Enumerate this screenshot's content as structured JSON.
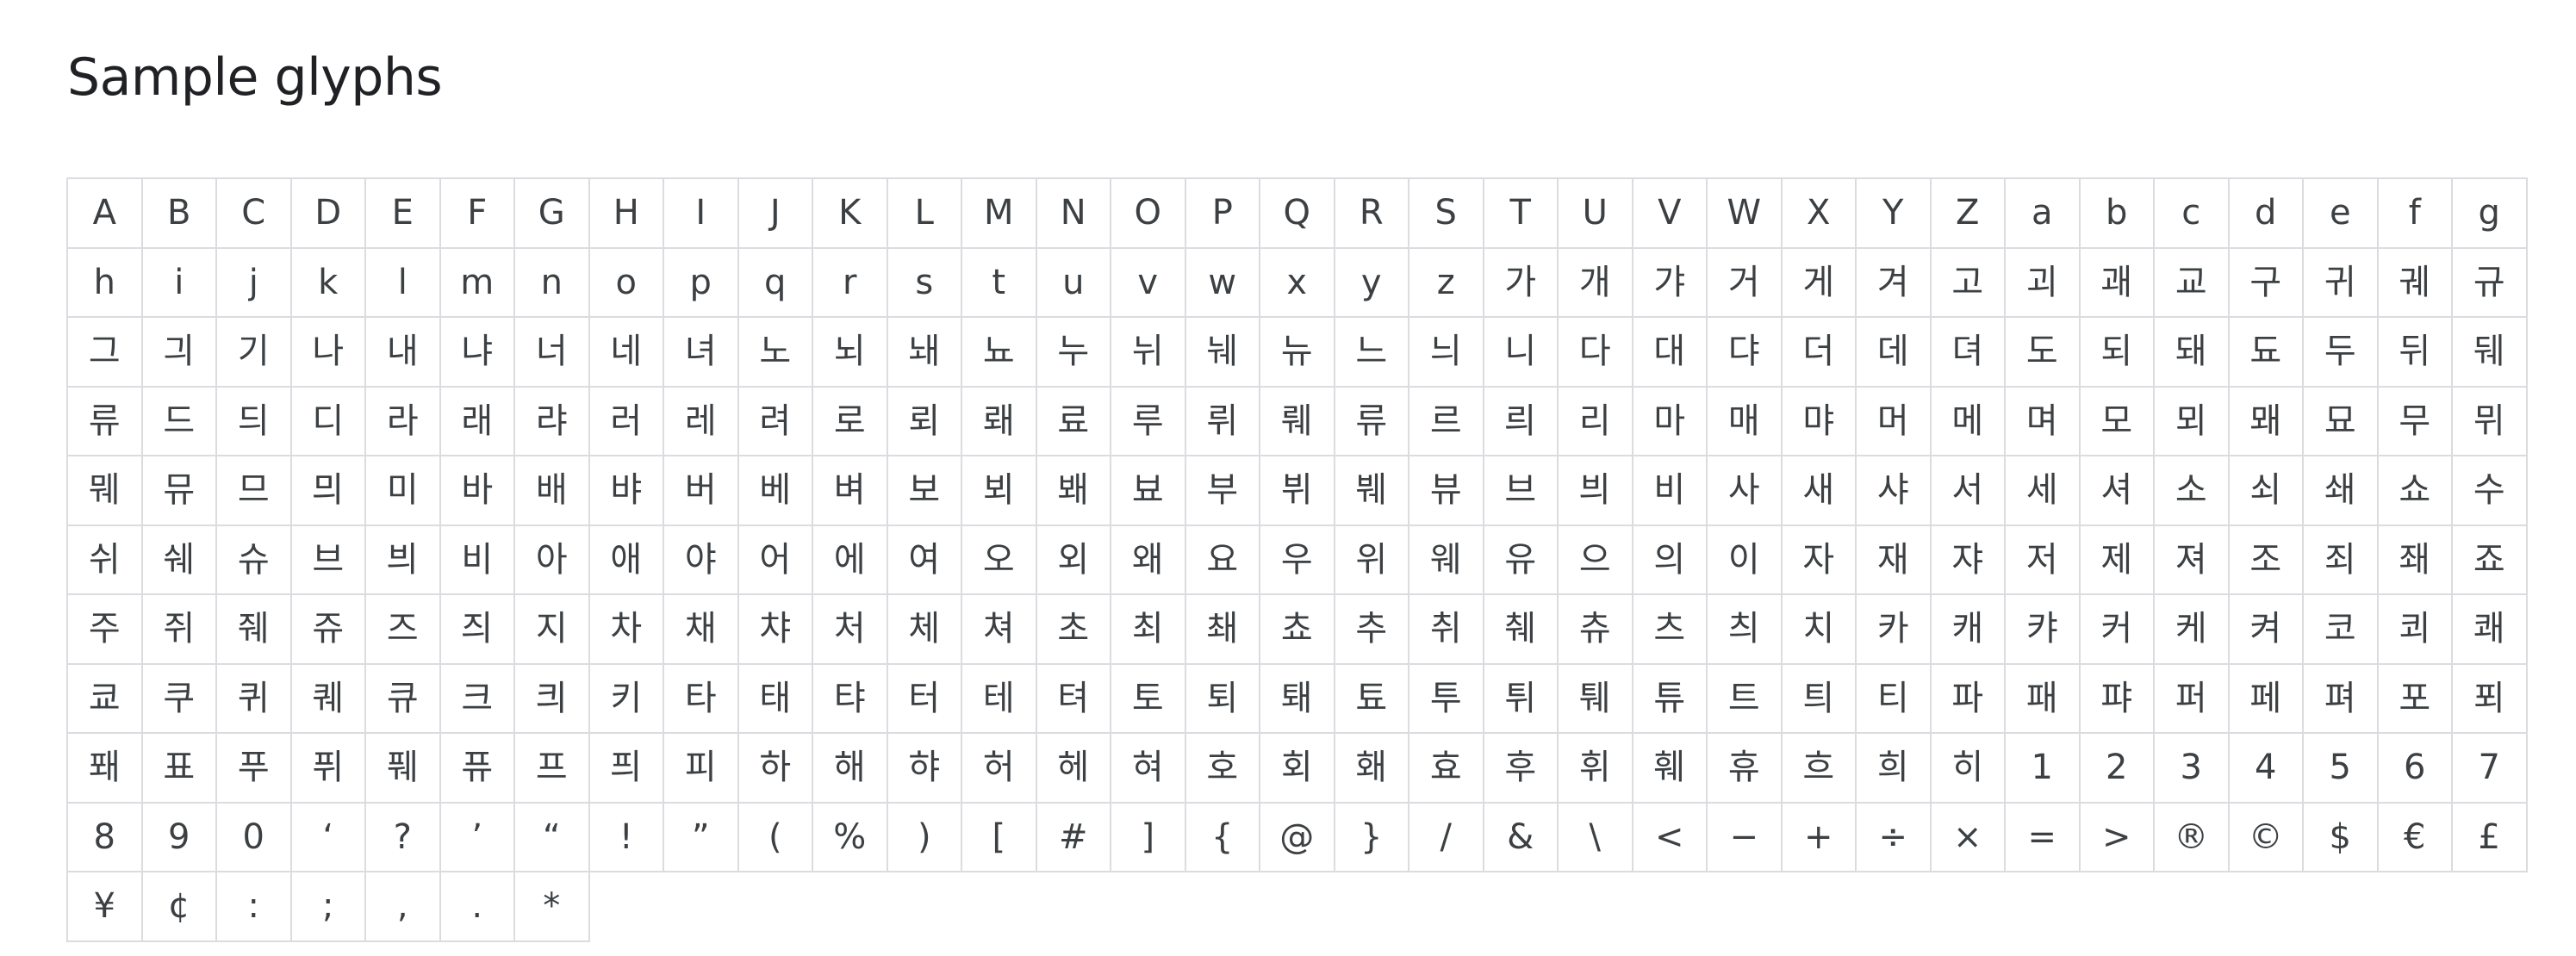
{
  "page": {
    "title": "Sample glyphs"
  },
  "glyphs": [
    "A",
    "B",
    "C",
    "D",
    "E",
    "F",
    "G",
    "H",
    "I",
    "J",
    "K",
    "L",
    "M",
    "N",
    "O",
    "P",
    "Q",
    "R",
    "S",
    "T",
    "U",
    "V",
    "W",
    "X",
    "Y",
    "Z",
    "a",
    "b",
    "c",
    "d",
    "e",
    "f",
    "g",
    "h",
    "i",
    "j",
    "k",
    "l",
    "m",
    "n",
    "o",
    "p",
    "q",
    "r",
    "s",
    "t",
    "u",
    "v",
    "w",
    "x",
    "y",
    "z",
    "가",
    "개",
    "갸",
    "거",
    "게",
    "겨",
    "고",
    "괴",
    "괘",
    "교",
    "구",
    "귀",
    "궤",
    "규",
    "그",
    "긔",
    "기",
    "나",
    "내",
    "냐",
    "너",
    "네",
    "녀",
    "노",
    "뇌",
    "놰",
    "뇨",
    "누",
    "뉘",
    "눼",
    "뉴",
    "느",
    "늬",
    "니",
    "다",
    "대",
    "댜",
    "더",
    "데",
    "뎌",
    "도",
    "되",
    "돼",
    "됴",
    "두",
    "뒤",
    "뒈",
    "류",
    "드",
    "듸",
    "디",
    "라",
    "래",
    "랴",
    "러",
    "레",
    "려",
    "로",
    "뢰",
    "뢔",
    "료",
    "루",
    "뤼",
    "뤠",
    "류",
    "르",
    "릐",
    "리",
    "마",
    "매",
    "먀",
    "머",
    "메",
    "며",
    "모",
    "뫼",
    "뫠",
    "묘",
    "무",
    "뮈",
    "뭬",
    "뮤",
    "므",
    "믜",
    "미",
    "바",
    "배",
    "뱌",
    "버",
    "베",
    "벼",
    "보",
    "뵈",
    "봬",
    "뵤",
    "부",
    "뷔",
    "붸",
    "뷰",
    "브",
    "븨",
    "비",
    "사",
    "새",
    "샤",
    "서",
    "세",
    "셔",
    "소",
    "쇠",
    "쇄",
    "쇼",
    "수",
    "쉬",
    "쉐",
    "슈",
    "브",
    "븨",
    "비",
    "아",
    "애",
    "야",
    "어",
    "에",
    "여",
    "오",
    "외",
    "왜",
    "요",
    "우",
    "위",
    "웨",
    "유",
    "으",
    "의",
    "이",
    "자",
    "재",
    "쟈",
    "저",
    "제",
    "져",
    "조",
    "죄",
    "좨",
    "죠",
    "주",
    "쥐",
    "줴",
    "쥬",
    "즈",
    "즤",
    "지",
    "차",
    "채",
    "챠",
    "처",
    "체",
    "쳐",
    "초",
    "최",
    "쵀",
    "쵸",
    "추",
    "취",
    "췌",
    "츄",
    "츠",
    "츼",
    "치",
    "카",
    "캐",
    "캬",
    "커",
    "케",
    "켜",
    "코",
    "쾨",
    "쾌",
    "쿄",
    "쿠",
    "퀴",
    "퀘",
    "큐",
    "크",
    "킈",
    "키",
    "타",
    "태",
    "탸",
    "터",
    "테",
    "텨",
    "토",
    "퇴",
    "퇘",
    "툐",
    "투",
    "튀",
    "퉤",
    "튜",
    "트",
    "틔",
    "티",
    "파",
    "패",
    "퍄",
    "퍼",
    "페",
    "펴",
    "포",
    "푀",
    "퐤",
    "표",
    "푸",
    "퓌",
    "풰",
    "퓨",
    "프",
    "픠",
    "피",
    "하",
    "해",
    "햐",
    "허",
    "헤",
    "혀",
    "호",
    "회",
    "홰",
    "효",
    "후",
    "휘",
    "훼",
    "휴",
    "흐",
    "희",
    "히",
    "1",
    "2",
    "3",
    "4",
    "5",
    "6",
    "7",
    "8",
    "9",
    "0",
    "‘",
    "?",
    "’",
    "“",
    "!",
    "”",
    "(",
    "%",
    ")",
    "[",
    "#",
    "]",
    "{",
    "@",
    "}",
    "/",
    "&",
    "\\",
    "<",
    "−",
    "+",
    "÷",
    "×",
    "=",
    ">",
    "®",
    "©",
    "$",
    "€",
    "£",
    "¥",
    "¢",
    ":",
    ";",
    ",",
    ".",
    "*"
  ]
}
